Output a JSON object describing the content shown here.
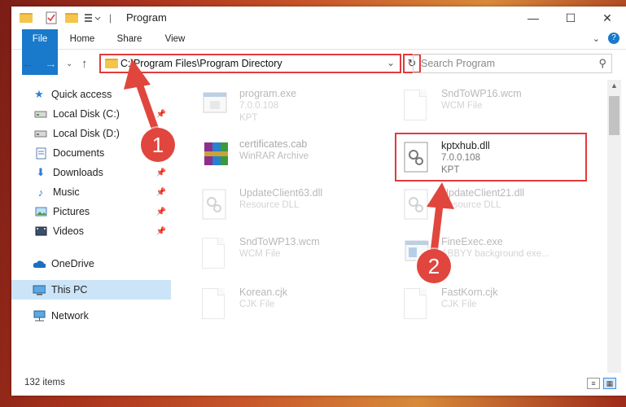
{
  "window": {
    "title": "Program"
  },
  "ribbon": {
    "tabs": [
      "File",
      "Home",
      "Share",
      "View"
    ]
  },
  "address": {
    "path": "C:\\Program Files\\Program Directory",
    "search_placeholder": "Search Program"
  },
  "nav": {
    "items": [
      {
        "label": "Quick access",
        "icon": "star-icon"
      },
      {
        "label": "Local Disk (C:)",
        "icon": "drive-icon",
        "pinned": true
      },
      {
        "label": "Local Disk (D:)",
        "icon": "drive-icon"
      },
      {
        "label": "Documents",
        "icon": "documents-icon",
        "pinned": true
      },
      {
        "label": "Downloads",
        "icon": "download-icon",
        "pinned": true
      },
      {
        "label": "Music",
        "icon": "music-icon",
        "pinned": true
      },
      {
        "label": "Pictures",
        "icon": "pictures-icon",
        "pinned": true
      },
      {
        "label": "Videos",
        "icon": "videos-icon",
        "pinned": true
      },
      {
        "label": "OneDrive",
        "icon": "cloud-icon"
      },
      {
        "label": "This PC",
        "icon": "computer-icon",
        "selected": true
      },
      {
        "label": "Network",
        "icon": "network-icon"
      }
    ]
  },
  "files": [
    {
      "name": "program.exe",
      "line1": "7.0.0.108",
      "line2": "KPT",
      "icon": "exe-icon"
    },
    {
      "name": "SndToWP16.wcm",
      "line1": "WCM File",
      "line2": "",
      "icon": "generic-file-icon"
    },
    {
      "name": "certificates.cab",
      "line1": "WinRAR Archive",
      "line2": "",
      "icon": "archive-icon"
    },
    {
      "name": "kptxhub.dll",
      "line1": "7.0.0.108",
      "line2": "KPT",
      "icon": "dll-icon"
    },
    {
      "name": "UpdateClient63.dll",
      "line1": "Resource DLL",
      "line2": "",
      "icon": "dll-icon"
    },
    {
      "name": "UpdateClient21.dll",
      "line1": "Resource DLL",
      "line2": "",
      "icon": "dll-icon"
    },
    {
      "name": "SndToWP13.wcm",
      "line1": "WCM File",
      "line2": "",
      "icon": "generic-file-icon"
    },
    {
      "name": "FineExec.exe",
      "line1": "ABBYY background exe...",
      "line2": "",
      "icon": "exe-icon"
    },
    {
      "name": "Korean.cjk",
      "line1": "CJK File",
      "line2": "",
      "icon": "generic-file-icon"
    },
    {
      "name": "FastKorn.cjk",
      "line1": "CJK File",
      "line2": "",
      "icon": "generic-file-icon"
    }
  ],
  "status": {
    "count": "132 items"
  },
  "annotations": {
    "step1": "1",
    "step2": "2"
  },
  "colors": {
    "accent": "#1979ca",
    "highlight": "#e23a3a",
    "selection": "#cce4f7"
  }
}
